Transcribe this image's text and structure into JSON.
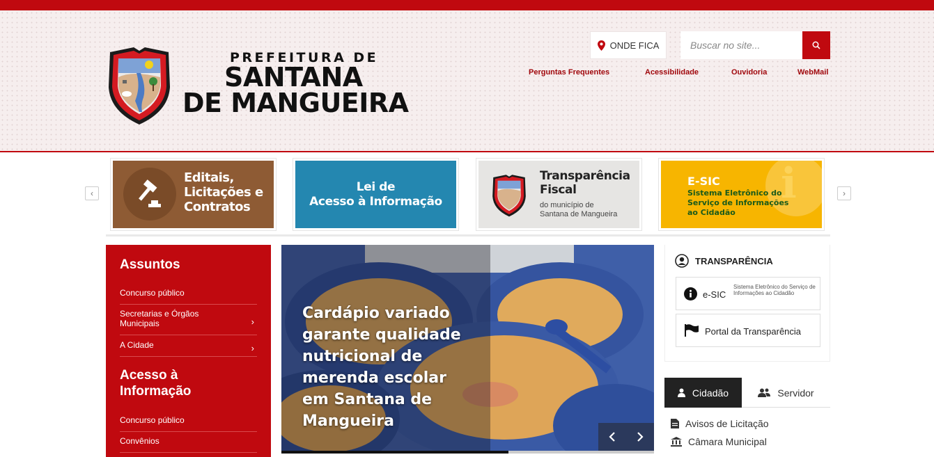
{
  "header": {
    "logo_alt": "Brasão de Santana de Mangueira",
    "logo_line1": "PREFEITURA DE",
    "logo_line2": "SANTANA",
    "logo_line3": "DE MANGUEIRA",
    "onde_fica": "ONDE FICA",
    "search_placeholder": "Buscar no site...",
    "links": [
      "Perguntas Frequentes",
      "Acessibilidade",
      "Ouvidoria",
      "WebMail"
    ]
  },
  "banners": {
    "editais": {
      "line1": "Editais,",
      "line2": "Licitações e",
      "line3": "Contratos"
    },
    "lai": {
      "line1": "Lei de",
      "line2": "Acesso à Informação"
    },
    "fiscal": {
      "line1": "Transparência",
      "line2": "Fiscal",
      "line3": "do município de",
      "line4": "Santana de Mangueira"
    },
    "esic": {
      "line1": "E-SIC",
      "line2": "Sistema Eletrônico do",
      "line3": "Serviço de Informações",
      "line4": "ao Cidadão"
    }
  },
  "sidebar": {
    "heading1": "Assuntos",
    "items1": [
      "Concurso público",
      "Secretarias e Órgãos Municipais",
      "A Cidade"
    ],
    "heading2": "Acesso à Informação",
    "items2": [
      "Concurso público",
      "Convênios"
    ]
  },
  "slider": {
    "headline": "Cardápio variado garante qualidade nutricional de merenda escolar em Santana de Mangueira",
    "progress": 0.61
  },
  "transparencia": {
    "title": "TRANSPARÊNCIA",
    "esic_label": "e-SIC",
    "esic_desc": "Sistema Eletrônico do Serviço de Informações ao Cidadão",
    "portal_label": "Portal da Transparência"
  },
  "tabs": {
    "cidadao": "Cidadão",
    "servidor": "Servidor",
    "items": [
      "Avisos de Licitação",
      "Câmara Municipal"
    ]
  },
  "colors": {
    "primary": "#c0090f",
    "dark": "#222222",
    "bg_header": "#f6eeee"
  }
}
